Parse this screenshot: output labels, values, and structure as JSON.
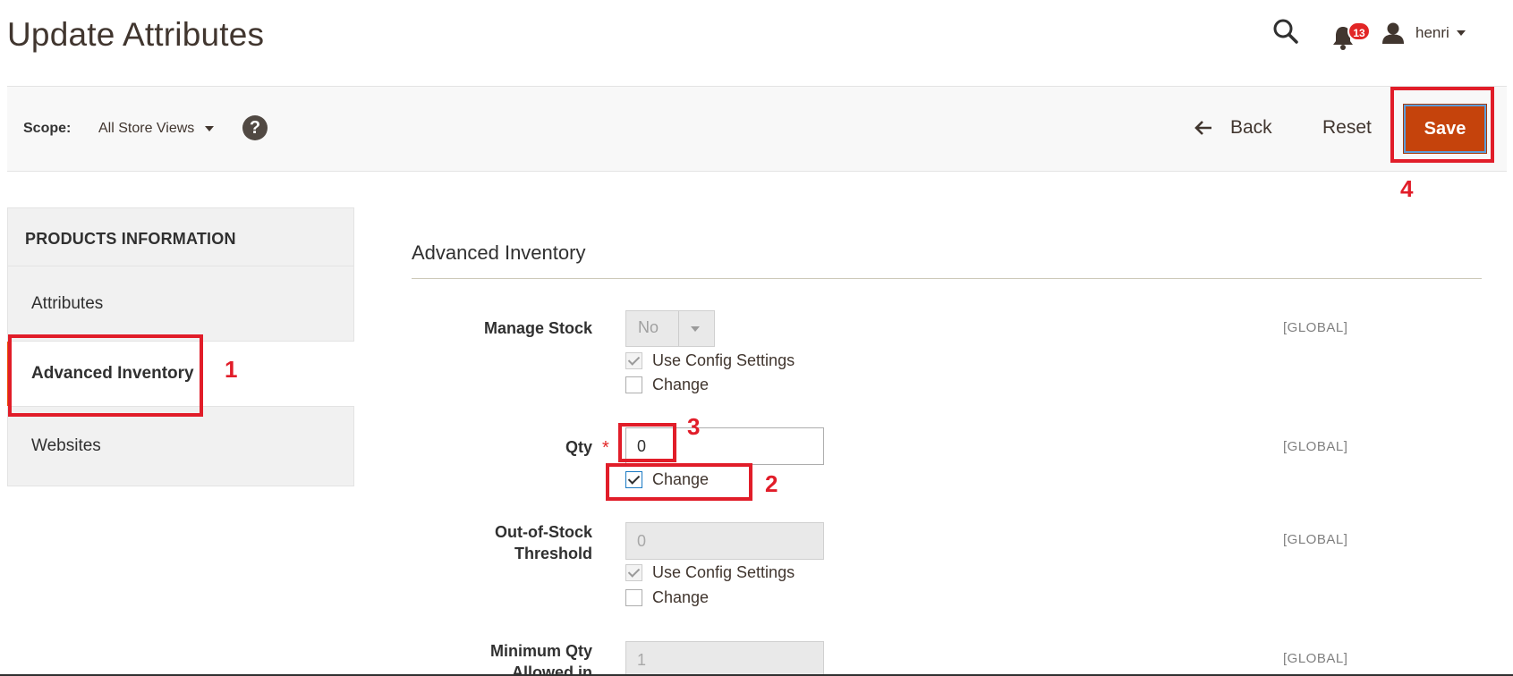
{
  "page": {
    "title": "Update Attributes"
  },
  "header": {
    "notifications_count": "13",
    "user_name": "henri"
  },
  "toolbar": {
    "scope_label": "Scope:",
    "scope_value": "All Store Views",
    "help_glyph": "?",
    "back_label": "Back",
    "reset_label": "Reset",
    "save_label": "Save"
  },
  "sidebar": {
    "title": "PRODUCTS INFORMATION",
    "items": [
      {
        "label": "Attributes",
        "active": false
      },
      {
        "label": "Advanced Inventory",
        "active": true
      },
      {
        "label": "Websites",
        "active": false
      }
    ]
  },
  "section": {
    "title": "Advanced Inventory"
  },
  "fields": {
    "manage_stock": {
      "label": "Manage Stock",
      "value": "No",
      "use_config_label": "Use Config Settings",
      "use_config_checked": true,
      "change_label": "Change",
      "change_checked": false,
      "scope": "[GLOBAL]"
    },
    "qty": {
      "label": "Qty",
      "required_mark": "*",
      "value": "0",
      "change_label": "Change",
      "change_checked": true,
      "scope": "[GLOBAL]"
    },
    "out_of_stock": {
      "label_line1": "Out-of-Stock",
      "label_line2": "Threshold",
      "value": "0",
      "use_config_label": "Use Config Settings",
      "use_config_checked": true,
      "change_label": "Change",
      "change_checked": false,
      "scope": "[GLOBAL]"
    },
    "min_qty": {
      "label_line1": "Minimum Qty",
      "label_line2": "Allowed in",
      "value": "1",
      "scope": "[GLOBAL]"
    }
  },
  "annotations": [
    "1",
    "2",
    "3",
    "4"
  ],
  "colors": {
    "accent": "#eb5202",
    "save_button": "#c5430c",
    "annotation": "#e11d29",
    "badge": "#e22626"
  },
  "icons": [
    "search-icon",
    "bell-icon",
    "user-icon",
    "chevron-down-icon",
    "help-icon",
    "arrow-left-icon"
  ]
}
